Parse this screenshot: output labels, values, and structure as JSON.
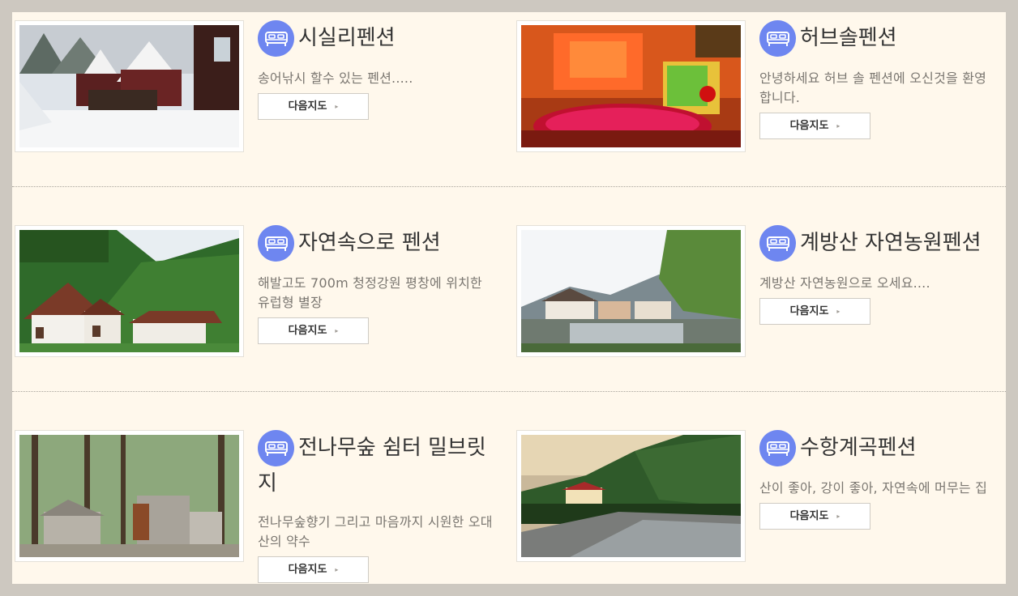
{
  "listings": [
    {
      "title": "시실리펜션",
      "description": "송어낚시 할수 있는 펜션.....",
      "button": "다음지도"
    },
    {
      "title": "허브솔펜션",
      "description": "안녕하세요 허브 솔 펜션에 오신것을 환영합니다.",
      "button": "다음지도"
    },
    {
      "title": "자연속으로 펜션",
      "description": "해발고도 700m 청정강원 평창에 위치한 유럽형 별장",
      "button": "다음지도"
    },
    {
      "title": "계방산 자연농원펜션",
      "description": "계방산 자연농원으로 오세요....",
      "button": "다음지도"
    },
    {
      "title": "전나무숲 쉼터 밀브릿지",
      "description": "전나무숲향기 그리고 마음까지 시원한 오대산의 약수",
      "button": "다음지도"
    },
    {
      "title": "수항계곡펜션",
      "description": "산이 좋아, 강이 좋아, 자연속에 머무는 집",
      "button": "다음지도"
    }
  ],
  "icons": {
    "listing_icon": "bed-icon",
    "button_arrow": "▸"
  },
  "colors": {
    "accent": "#6e86f0",
    "panel": "#fff8ec",
    "frame": "#cdc8c0"
  }
}
